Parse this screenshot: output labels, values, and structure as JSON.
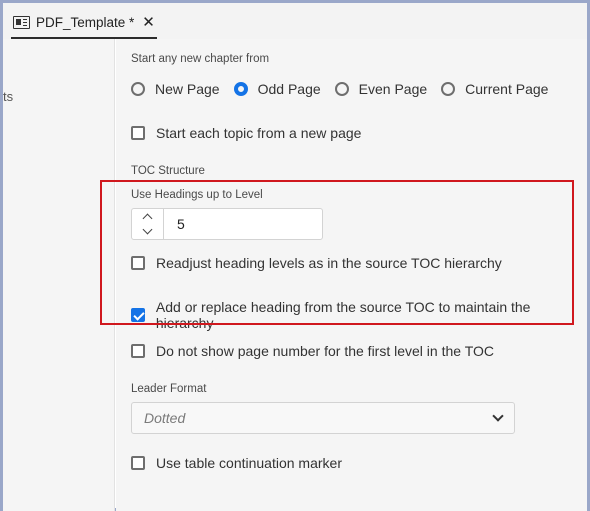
{
  "tab": {
    "title": "PDF_Template *",
    "close": "✕"
  },
  "leftpane": {
    "partial_text": "ts"
  },
  "chapter": {
    "label": "Start any new chapter from",
    "options": [
      "New Page",
      "Odd Page",
      "Even Page",
      "Current Page"
    ],
    "selected": "Odd Page"
  },
  "topic_new_page": {
    "label": "Start each topic from a new page",
    "checked": false
  },
  "toc": {
    "label": "TOC Structure",
    "headings_label": "Use Headings up to Level",
    "headings_value": "5",
    "readjust_label": "Readjust heading levels as in the source TOC hierarchy",
    "readjust_checked": false,
    "add_replace_label": "Add or replace heading from the source TOC to maintain the hierarchy",
    "add_replace_checked": true,
    "no_page_number_label": "Do not show page number for the first level in the TOC",
    "no_page_number_checked": false
  },
  "leader": {
    "label": "Leader Format",
    "value": "Dotted"
  },
  "table_marker": {
    "label": "Use table continuation marker",
    "checked": false
  },
  "colors": {
    "accent": "#1473e6",
    "highlight": "#d0181e",
    "frame": "#9aa7c9"
  }
}
